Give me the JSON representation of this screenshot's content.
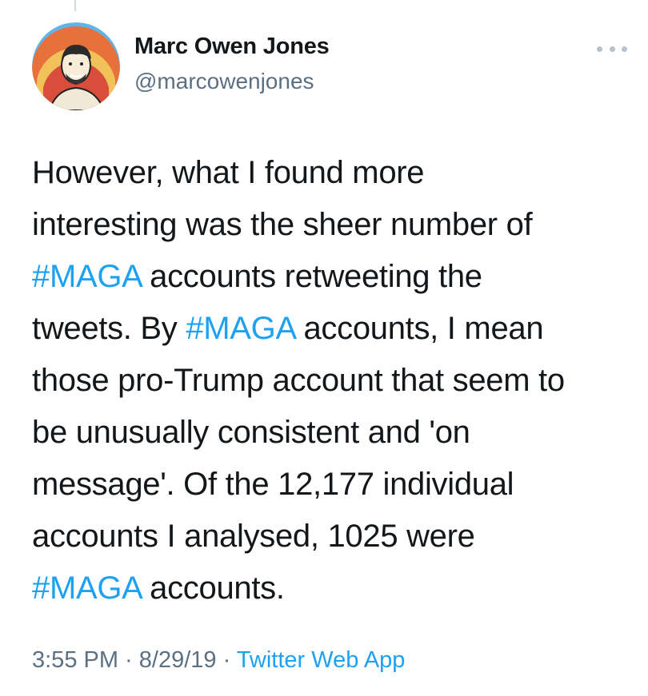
{
  "author": {
    "name": "Marc Owen Jones",
    "handle": "@marcowenjones"
  },
  "tweet": {
    "lines": [
      [
        {
          "text": "However, what I found more"
        }
      ],
      [
        {
          "text": "interesting was the sheer number of"
        }
      ],
      [
        {
          "text": "#MAGA",
          "hashtag": true
        },
        {
          "text": " accounts retweeting the"
        }
      ],
      [
        {
          "text": "tweets. By "
        },
        {
          "text": "#MAGA",
          "hashtag": true
        },
        {
          "text": " accounts, I mean"
        }
      ],
      [
        {
          "text": "those pro-Trump account that seem to"
        }
      ],
      [
        {
          "text": "be unusually consistent and 'on"
        }
      ],
      [
        {
          "text": "message'. Of the 12,177 individual"
        }
      ],
      [
        {
          "text": "accounts I analysed, 1025 were"
        }
      ],
      [
        {
          "text": "#MAGA",
          "hashtag": true
        },
        {
          "text": " accounts."
        }
      ]
    ]
  },
  "meta": {
    "time": "3:55 PM",
    "separator": " · ",
    "date": "8/29/19",
    "source": "Twitter Web App"
  },
  "icons": {
    "more": "more-options-icon",
    "avatar": "profile-avatar"
  },
  "colors": {
    "hashtag": "#1da1f2",
    "secondary": "#5b7083",
    "text": "#14171a"
  }
}
